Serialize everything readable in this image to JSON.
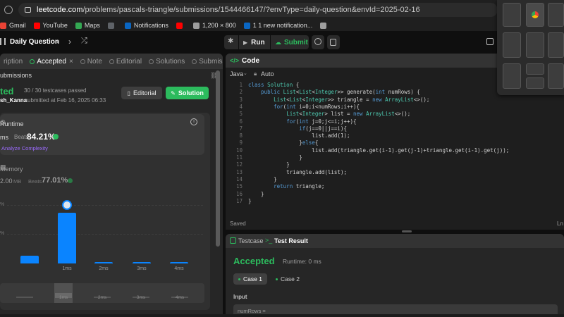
{
  "browser": {
    "url_host": "leetcode.com",
    "url_path": "/problems/pascals-triangle/submissions/1544466147/?envType=daily-question&envId=2025-02-16",
    "bookmarks": [
      {
        "label": "Gmail",
        "color": "#ea4335"
      },
      {
        "label": "YouTube",
        "color": "#ff0000"
      },
      {
        "label": "Maps",
        "color": "#34a853"
      },
      {
        "label": "",
        "color": "#5f6368"
      },
      {
        "label": "Notifications",
        "color": "#0a66c2"
      },
      {
        "label": "",
        "color": "#ff0000"
      },
      {
        "label": "1,200 × 800",
        "color": "#9e9e9e"
      },
      {
        "label": "1 1 new notification...",
        "color": "#0a66c2"
      },
      {
        "label": "",
        "color": "#9e9e9e"
      }
    ]
  },
  "topbar": {
    "daily_question": "Daily Question",
    "run": "Run",
    "submit": "Submit"
  },
  "left_tabs": [
    {
      "label": "ription",
      "active": false
    },
    {
      "label": "Accepted",
      "active": true
    },
    {
      "label": "Note",
      "active": false
    },
    {
      "label": "Editorial",
      "active": false
    },
    {
      "label": "Solutions",
      "active": false
    },
    {
      "label": "Submission",
      "active": false
    }
  ],
  "submission": {
    "back_label": "ubmissions",
    "status": "ted",
    "testcases": "30 / 30 testcases passed",
    "user": "sh_Kanna",
    "submitted": "submitted at Feb 16, 2025 06:33",
    "editorial_btn": "Editorial",
    "solution_btn": "Solution"
  },
  "runtime": {
    "label": "Runtime",
    "value": "ms",
    "beats_label": "Beats",
    "beats": "84.21%",
    "analyze": "Analyze Complexity"
  },
  "memory": {
    "label": "Memory",
    "value": "2.00",
    "unit": "MB",
    "beats_label": "Beats",
    "beats": "77.01%"
  },
  "chart_data": {
    "type": "bar",
    "categories": [
      "",
      "1ms",
      "2ms",
      "3ms",
      "4ms"
    ],
    "values": [
      6,
      40,
      1,
      1,
      1
    ],
    "y_ticks": [
      "%",
      "%"
    ],
    "ylim": [
      0,
      50
    ],
    "mini_labels": [
      "1ms",
      "2ms",
      "3ms",
      "4ms"
    ]
  },
  "code": {
    "tab": "Code",
    "language": "Java",
    "mode": "Auto",
    "lines": [
      "class Solution {",
      "    public List<List<Integer>> generate(int numRows) {",
      "        List<List<Integer>> triangle = new ArrayList<>();",
      "        for(int i=0;i<numRows;i++){",
      "            List<Integer> list = new ArrayList<>();",
      "            for(int j=0;j<=i;j++){",
      "                if(j==0||j==i){",
      "                    list.add(1);",
      "                }else{",
      "                    list.add(triangle.get(i-1).get(j-1)+triangle.get(i-1).get(j));",
      "                }",
      "            }",
      "            triangle.add(list);",
      "        }",
      "        return triangle;",
      "    }",
      "}"
    ],
    "saved": "Saved",
    "cursor": "Ln"
  },
  "result": {
    "testcase_tab": "Testcase",
    "result_tab": "Test Result",
    "status": "Accepted",
    "runtime": "Runtime: 0 ms",
    "case1": "Case 1",
    "case2": "Case 2",
    "input_label": "Input",
    "input_value": "numRows ="
  }
}
